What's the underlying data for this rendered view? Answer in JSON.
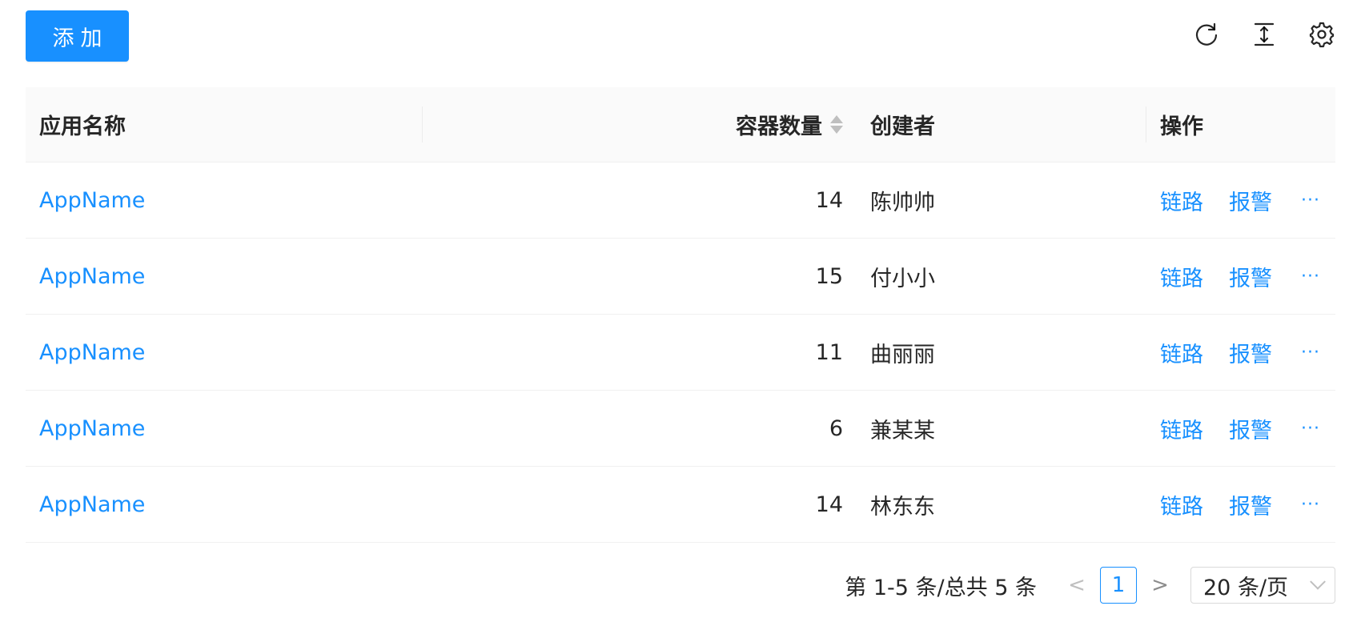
{
  "toolbar": {
    "add_label": "添加",
    "icons": [
      "reload-icon",
      "column-height-icon",
      "setting-icon"
    ]
  },
  "table": {
    "columns": [
      {
        "label": "应用名称"
      },
      {
        "label": "容器数量",
        "sortable": true
      },
      {
        "label": "创建者"
      },
      {
        "label": "操作"
      }
    ],
    "rows": [
      {
        "name": "AppName",
        "containers": "14",
        "creator": "陈帅帅",
        "action1": "链路",
        "action2": "报警",
        "more": "···"
      },
      {
        "name": "AppName",
        "containers": "15",
        "creator": "付小小",
        "action1": "链路",
        "action2": "报警",
        "more": "···"
      },
      {
        "name": "AppName",
        "containers": "11",
        "creator": "曲丽丽",
        "action1": "链路",
        "action2": "报警",
        "more": "···"
      },
      {
        "name": "AppName",
        "containers": "6",
        "creator": "兼某某",
        "action1": "链路",
        "action2": "报警",
        "more": "···"
      },
      {
        "name": "AppName",
        "containers": "14",
        "creator": "林东东",
        "action1": "链路",
        "action2": "报警",
        "more": "···"
      }
    ]
  },
  "pagination": {
    "total_text": "第 1-5 条/总共 5 条",
    "current_page": "1",
    "prev": "<",
    "next": ">",
    "page_size": "20 条/页"
  },
  "colors": {
    "primary": "#1890ff",
    "header_bg": "#fafafa",
    "border": "#f0f0f0"
  }
}
